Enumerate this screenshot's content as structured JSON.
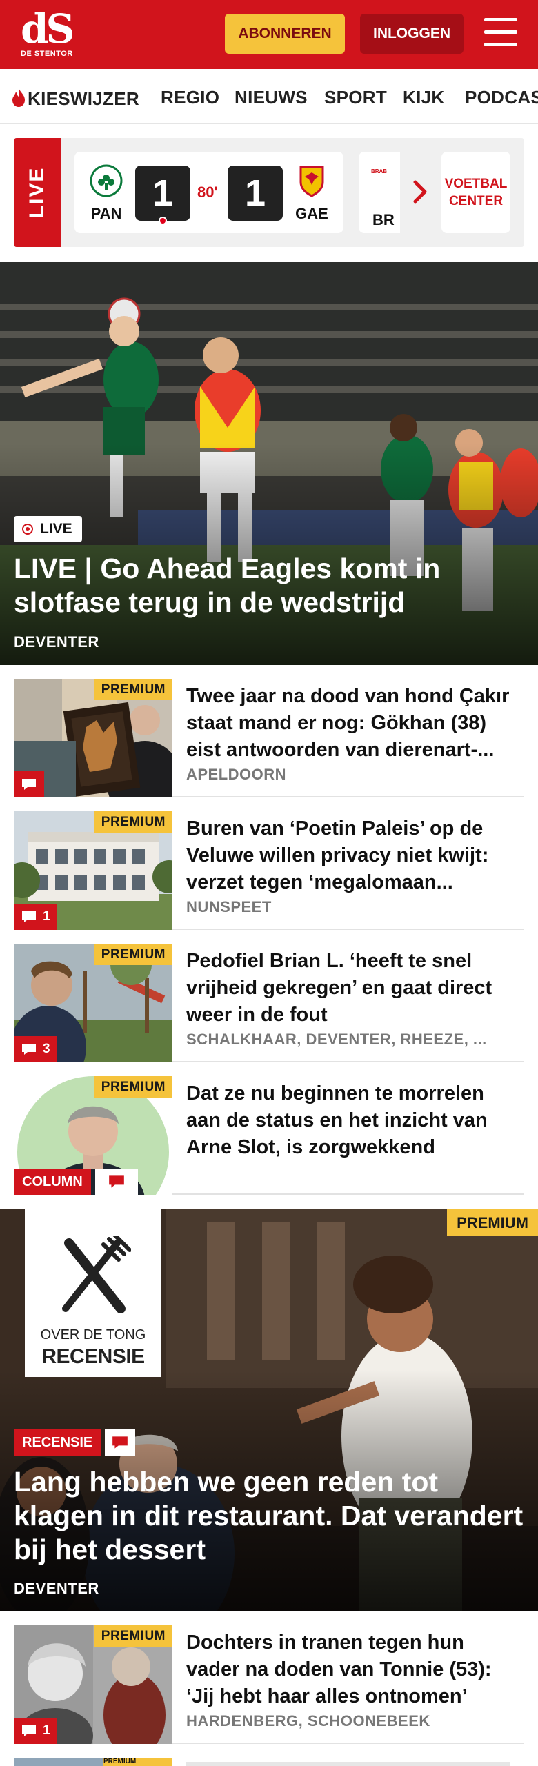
{
  "header": {
    "logo_mark": "dS",
    "logo_sub": "DE STENTOR",
    "subscribe_label": "ABONNEREN",
    "login_label": "INLOGGEN"
  },
  "nav": {
    "items": [
      "KIESWIJZER",
      "REGIO",
      "NIEUWS",
      "SPORT",
      "KIJK",
      "PODCAS"
    ]
  },
  "live": {
    "label": "LIVE",
    "home_team": "PAN",
    "home_score": "1",
    "minute": "80'",
    "away_score": "1",
    "away_team": "GAE",
    "next_team": "BR",
    "next_crest_text": "BRAB",
    "button_label": "VOETBAL CENTER"
  },
  "hero": {
    "chip": "LIVE",
    "title": "LIVE | Go Ahead Eagles komt in slotfase terug in de wedstrijd",
    "place": "DEVENTER"
  },
  "articles": [
    {
      "title": "Twee jaar na dood van hond Çakır staat mand er nog: Gökhan (38) eist antwoorden van dierenart-...",
      "place": "APELDOORN",
      "badge": "PREMIUM",
      "comments": ""
    },
    {
      "title": "Buren van ‘Poetin Paleis’ op de Veluwe willen privacy niet kwijt: verzet tegen ‘megalomaan...",
      "place": "NUNSPEET",
      "badge": "PREMIUM",
      "comments": "1"
    },
    {
      "title": "Pedofiel Brian L. ‘heeft te snel vrijheid gekregen’ en gaat direct weer in de fout",
      "place": "SCHALKHAAR, DEVENTER, RHEEZE, ...",
      "badge": "PREMIUM",
      "comments": "3"
    },
    {
      "title": "Dat ze nu beginnen te morrelen aan de status en het inzicht van Arne Slot, is zorgwekkend",
      "place": "",
      "badge": "PREMIUM",
      "tag": "COLUMN"
    }
  ],
  "review": {
    "badge": "PREMIUM",
    "logo_line1": "OVER DE TONG",
    "logo_line2": "RECENSIE",
    "tag": "RECENSIE",
    "title": "Lang hebben we geen reden tot klagen in dit restaurant. Dat verandert bij het dessert",
    "place": "DEVENTER"
  },
  "article_after": {
    "title": "Dochters in tranen tegen hun vader na doden van Tonnie (53): ‘Jij hebt haar alles ontnomen’",
    "place": "HARDENBERG, SCHOONEBEEK",
    "badge": "PREMIUM",
    "comments": "1"
  },
  "article_peek": {
    "badge": "PREMIUM"
  },
  "colors": {
    "brand_red": "#d1141c",
    "premium_yellow": "#f5c33b",
    "dark_red": "#a50e16"
  }
}
